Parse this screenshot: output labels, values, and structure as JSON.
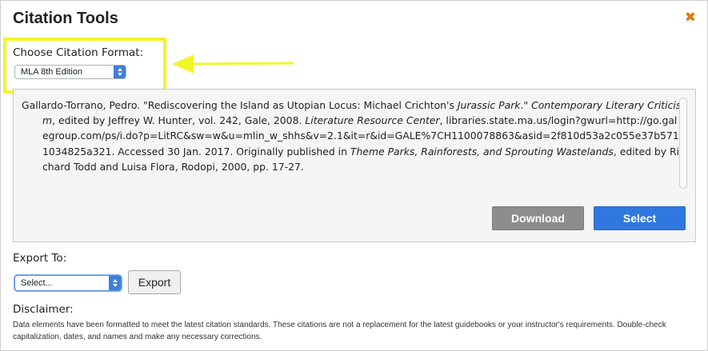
{
  "dialog": {
    "title": "Citation Tools",
    "close_icon": "close-icon",
    "close_glyph": "✖"
  },
  "format": {
    "label": "Choose Citation Format:",
    "selected": "MLA 8th Edition"
  },
  "annotation": {
    "highlight_color": "#f2f52a",
    "arrow": "left-pointing-arrow"
  },
  "citation": {
    "author": "Gallardo-Torrano, Pedro. \"Rediscovering the Island as Utopian Locus: Michael Crichton's ",
    "work_title": "Jurassic Park",
    "after_work": ".\" ",
    "collection": "Contemporary Literary Criticism",
    "editors": ", edited by Jeffrey W. Hunter, vol. 242, Gale, 2008. ",
    "database": "Literature Resource Center",
    "url_access": ", libraries.state.ma.us/login?gwurl=http://go.galegroup.com/ps/i.do?p=LitRC&sw=w&u=mlin_w_shhs&v=2.1&it=r&id=GALE%7CH1100078863&asid=2f810d53a2c055e37b5711034825a321. Accessed 30 Jan. 2017. Originally published in ",
    "orig_title": "Theme Parks, Rainforests, and Sprouting Wastelands",
    "orig_details": ", edited by Richard Todd and Luisa Flora, Rodopi, 2000, pp. 17-27."
  },
  "actions": {
    "download_label": "Download",
    "select_label": "Select"
  },
  "export": {
    "label": "Export To:",
    "selected": "Select...",
    "button_label": "Export"
  },
  "disclaimer": {
    "label": "Disclaimer:",
    "text": "Data elements have been formatted to meet the latest citation standards. These citations are not a replacement for the latest guidebooks or your instructor's requirements. Double-check capitalization, dates, and names and make any necessary corrections."
  },
  "colors": {
    "accent": "#2f78e0",
    "close": "#e07a10",
    "download": "#8d8d8d"
  }
}
